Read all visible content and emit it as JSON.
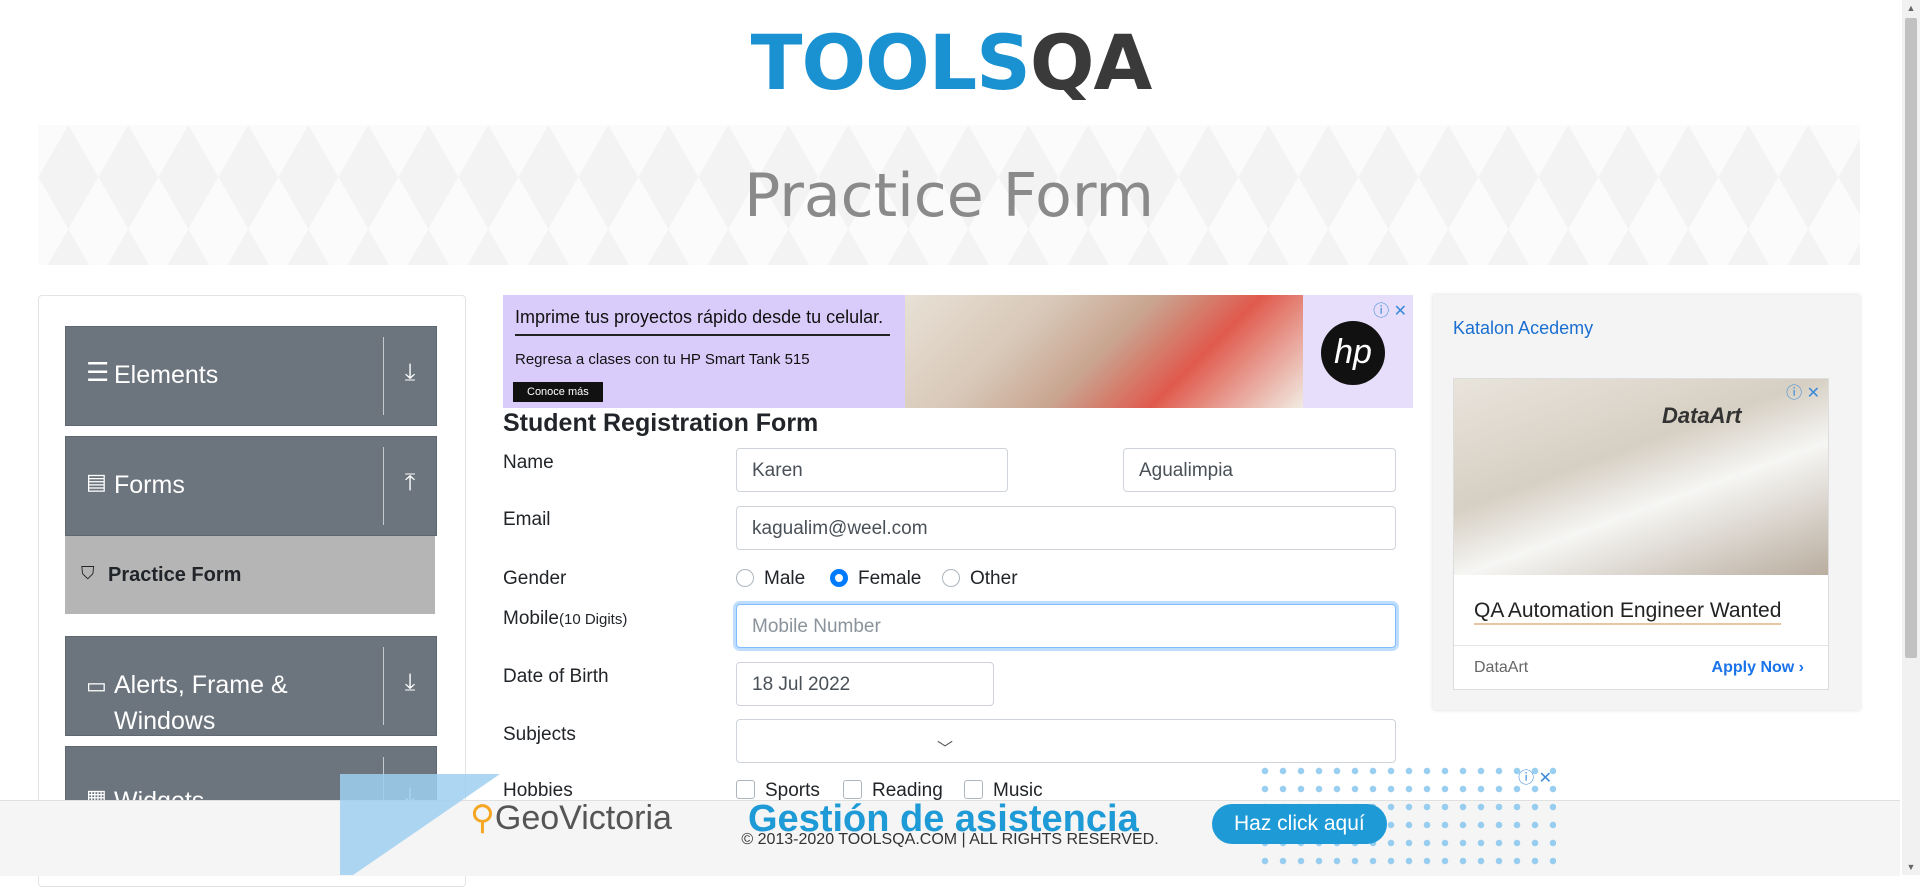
{
  "header": {
    "logo_main": "TOOLS",
    "logo_accent": "QA"
  },
  "banner": {
    "title": "Practice Form"
  },
  "sidebar": {
    "groups": [
      {
        "label": "Elements",
        "icon": "menu-lines-icon",
        "arrow": "download-arrow-icon"
      },
      {
        "label": "Forms",
        "icon": "document-icon",
        "arrow": "upload-arrow-icon"
      },
      {
        "label": "Alerts, Frame &",
        "label2": "Windows",
        "icon": "window-icon",
        "arrow": "download-arrow-icon"
      },
      {
        "label": "Widgets",
        "icon": "widgets-icon",
        "arrow": "download-arrow-icon"
      }
    ],
    "submenu": {
      "label": "Practice Form",
      "icon": "html5-icon"
    }
  },
  "top_ad": {
    "line1": "Imprime tus proyectos rápido desde tu celular.",
    "line2": "Regresa a clases con tu HP Smart Tank 515",
    "cta": "Conoce más",
    "brand": "hp"
  },
  "form": {
    "title": "Student Registration Form",
    "name_label": "Name",
    "first_name": "Karen",
    "last_name": "Agualimpia",
    "email_label": "Email",
    "email": "kagualim@weel.com",
    "gender_label": "Gender",
    "gender_options": [
      "Male",
      "Female",
      "Other"
    ],
    "gender_selected": "Female",
    "mobile_label": "Mobile",
    "mobile_hint": "(10 Digits)",
    "mobile_placeholder": "Mobile Number",
    "dob_label": "Date of Birth",
    "dob": "18 Jul 2022",
    "subjects_label": "Subjects",
    "hobbies_label": "Hobbies",
    "hobbies": [
      "Sports",
      "Reading",
      "Music"
    ]
  },
  "right_ad": {
    "katalon_alt": "Katalon Acedemy",
    "company_logo": "DataArt",
    "job_title": "QA Automation Engineer Wanted",
    "company": "DataArt",
    "apply": "Apply Now"
  },
  "bottom_ad": {
    "brand": "GeoVictoria",
    "headline": "Gestión de asistencia",
    "cta": "Haz click aquí"
  },
  "footer": {
    "copyright": "© 2013-2020 TOOLSQA.COM | ALL RIGHTS RESERVED."
  },
  "colors": {
    "primary": "#007bff",
    "sidebar_bg": "#6c757d",
    "logo_blue": "#1a91d1"
  }
}
